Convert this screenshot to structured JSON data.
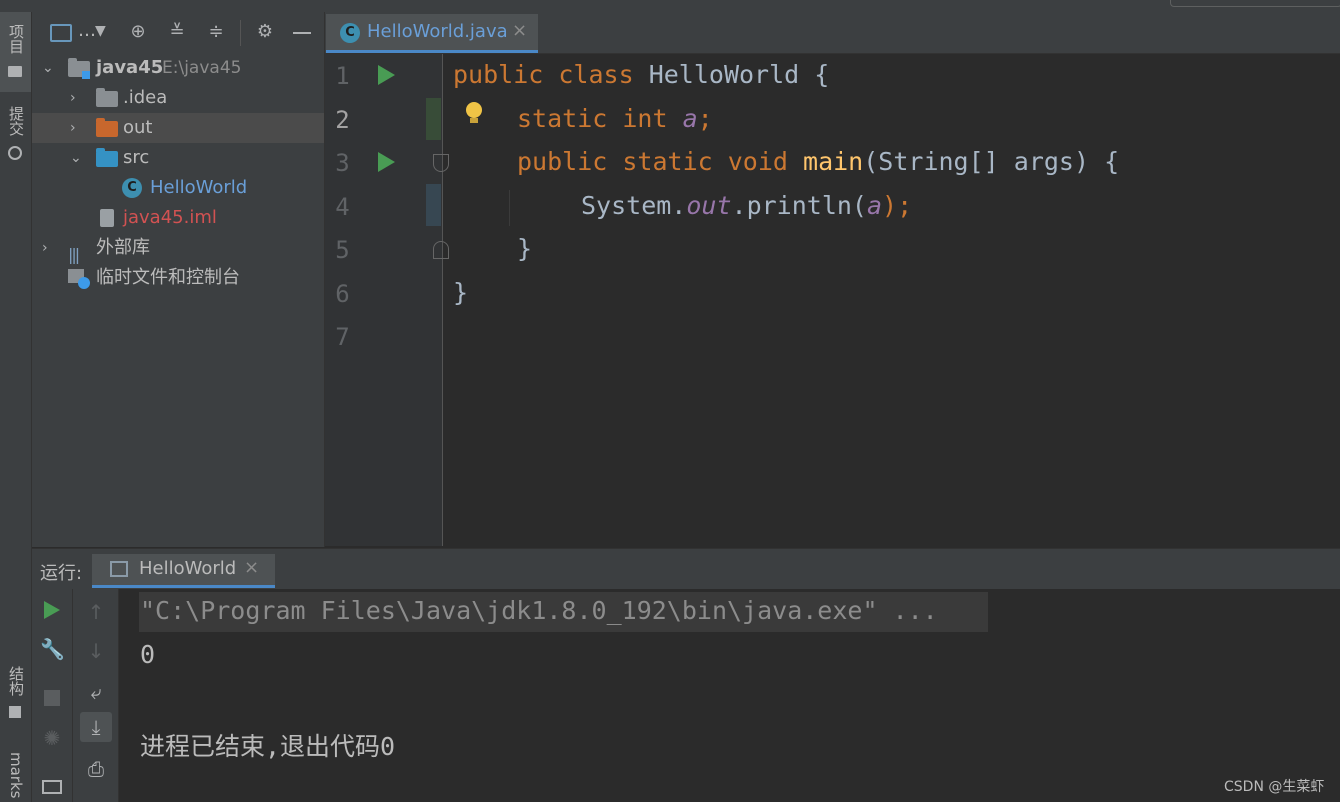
{
  "left_stripe": {
    "project_label": "项目",
    "commit_label": "提交",
    "structure_label": "结构",
    "bookmarks_label": "marks"
  },
  "project_panel": {
    "view_selector": "…",
    "tree": [
      {
        "label": "java45",
        "hint": "E:\\java45"
      },
      {
        "label": ".idea"
      },
      {
        "label": "out"
      },
      {
        "label": "src"
      },
      {
        "label": "HelloWorld"
      },
      {
        "label": "java45.iml"
      },
      {
        "label": "外部库"
      },
      {
        "label": "临时文件和控制台"
      }
    ]
  },
  "editor": {
    "tab_label": "HelloWorld.java",
    "line_numbers": [
      "1",
      "2",
      "3",
      "4",
      "5",
      "6",
      "7"
    ],
    "code": {
      "l1": {
        "kw1": "public",
        "kw2": "class",
        "name": "HelloWorld",
        "brace": "{"
      },
      "l2": {
        "kw1": "static",
        "kw2": "int",
        "var": "a",
        "semi": ";"
      },
      "l3": {
        "kw1": "public",
        "kw2": "static",
        "kw3": "void",
        "fn": "main",
        "args": "(String[] args) {"
      },
      "l4": {
        "pre": "System.",
        "field": "out",
        "mid": ".println(",
        "var": "a",
        "post": ");"
      },
      "l5": {
        "text": "}"
      },
      "l6": {
        "text": "}"
      }
    }
  },
  "run_panel": {
    "label": "运行:",
    "tab_label": "HelloWorld",
    "output": [
      "\"C:\\Program Files\\Java\\jdk1.8.0_192\\bin\\java.exe\" ...",
      "0",
      "",
      "进程已结束,退出代码0"
    ]
  },
  "watermark": "CSDN @生菜虾",
  "colors": {
    "keyword": "#cc7832",
    "function": "#ffc66d",
    "field": "#9876aa",
    "run_green": "#499c54",
    "accent": "#4a88c7"
  }
}
